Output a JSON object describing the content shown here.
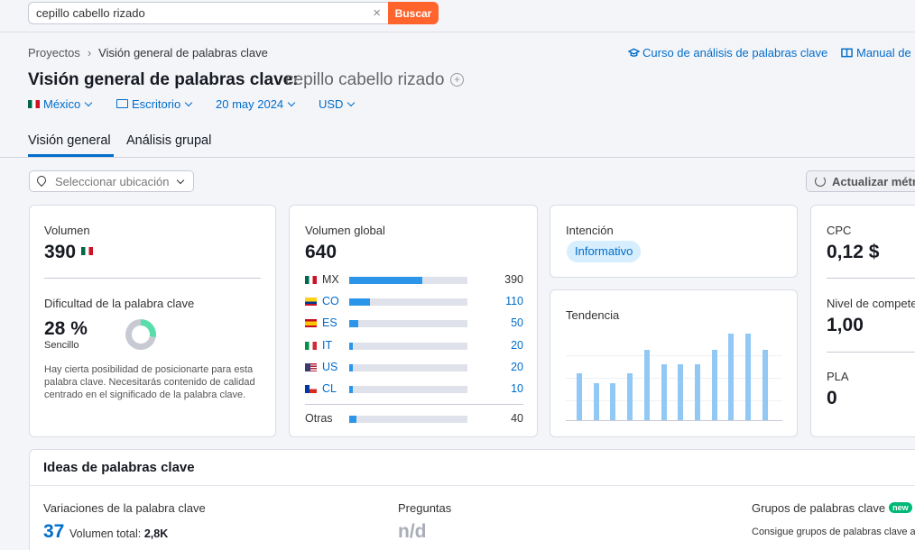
{
  "search": {
    "value": "cepillo cabello rizado",
    "clear_glyph": "×",
    "button_label": "Buscar"
  },
  "breadcrumb": {
    "root": "Proyectos",
    "separator": "›",
    "current": "Visión general de palabras clave"
  },
  "links": {
    "course": "Curso de análisis de palabras clave",
    "manual": "Manual de"
  },
  "title": {
    "label": "Visión general de palabras clave:",
    "keyword": "cepillo cabello rizado",
    "add_glyph": "+"
  },
  "filters": {
    "country": "México",
    "device": "Escritorio",
    "date": "20 may 2024",
    "currency": "USD"
  },
  "tabs": [
    "Visión general",
    "Análisis grupal"
  ],
  "toolbar": {
    "location_placeholder": "Seleccionar ubicación",
    "refresh_label": "Actualizar métri"
  },
  "volume": {
    "label": "Volumen",
    "value": "390"
  },
  "difficulty": {
    "label": "Dificultad de la palabra clave",
    "value": "28 %",
    "percent": 28,
    "level": "Sencillo",
    "description": "Hay cierta posibilidad de posicionarte para esta palabra clave. Necesitarás contenido de calidad centrado en el significado de la palabra clave."
  },
  "global_volume": {
    "label": "Volumen global",
    "value": "640",
    "countries": [
      {
        "code": "MX",
        "value": "390",
        "share": 0.609,
        "link": false
      },
      {
        "code": "CO",
        "value": "110",
        "share": 0.172,
        "link": true
      },
      {
        "code": "ES",
        "value": "50",
        "share": 0.078,
        "link": true
      },
      {
        "code": "IT",
        "value": "20",
        "share": 0.031,
        "link": true
      },
      {
        "code": "US",
        "value": "20",
        "share": 0.031,
        "link": true
      },
      {
        "code": "CL",
        "value": "10",
        "share": 0.016,
        "link": true
      }
    ],
    "others": {
      "label": "Otras",
      "value": "40",
      "share": 0.063
    }
  },
  "intent": {
    "label": "Intención",
    "badge": "Informativo"
  },
  "trend": {
    "label": "Tendencia",
    "values": [
      0.54,
      0.43,
      0.43,
      0.54,
      0.81,
      0.65,
      0.65,
      0.65,
      0.81,
      1.0,
      1.0,
      0.81
    ]
  },
  "metrics": {
    "cpc_label": "CPC",
    "cpc_value": "0,12 $",
    "competition_label": "Nivel de compete",
    "competition_value": "1,00",
    "pla_label": "PLA",
    "pla_value": "0"
  },
  "ideas": {
    "title": "Ideas de palabras clave",
    "variations_label": "Variaciones de la palabra clave",
    "variations_count": "37",
    "total_volume_label": "Volumen total:",
    "total_volume_value": "2,8K",
    "questions_label": "Preguntas",
    "questions_value": "n/d",
    "groups_label": "Grupos de palabras clave",
    "groups_badge": "new",
    "groups_desc": "Consigue grupos de palabras clave a"
  },
  "colors": {
    "accent": "#006dca",
    "search_button": "#ff642d",
    "bar_fill": "#2b95e9",
    "trend_bar": "#92c8f4",
    "kd_green": "#59ddaa"
  }
}
